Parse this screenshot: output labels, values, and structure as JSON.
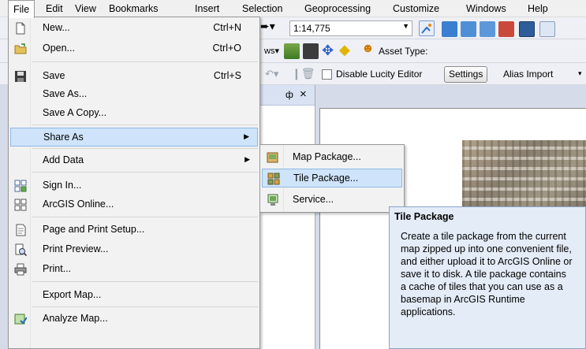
{
  "menubar": {
    "items": [
      {
        "label": "File",
        "name": "file"
      },
      {
        "label": "Edit",
        "name": "edit"
      },
      {
        "label": "View",
        "name": "view"
      },
      {
        "label": "Bookmarks",
        "name": "bookmarks"
      },
      {
        "label": "Insert",
        "name": "insert"
      },
      {
        "label": "Selection",
        "name": "selection"
      },
      {
        "label": "Geoprocessing",
        "name": "geoprocessing"
      },
      {
        "label": "Customize",
        "name": "customize"
      },
      {
        "label": "Windows",
        "name": "windows"
      },
      {
        "label": "Help",
        "name": "help"
      }
    ]
  },
  "toolbar": {
    "scale_value": "1:14,775",
    "asset_type_label": "Asset Type:",
    "disable_lucity_label": "Disable Lucity Editor",
    "settings_label": "Settings",
    "alias_import_label": "Alias Import",
    "pane_pin_glyph": "ф",
    "pane_close_glyph": "×"
  },
  "file_menu": {
    "new": {
      "label": "New...",
      "shortcut": "Ctrl+N"
    },
    "open": {
      "label": "Open...",
      "shortcut": "Ctrl+O"
    },
    "save": {
      "label": "Save",
      "shortcut": "Ctrl+S"
    },
    "save_as": {
      "label": "Save As..."
    },
    "save_copy": {
      "label": "Save A Copy..."
    },
    "share_as": {
      "label": "Share As"
    },
    "add_data": {
      "label": "Add Data"
    },
    "sign_in": {
      "label": "Sign In..."
    },
    "arcgis_online": {
      "label": "ArcGIS Online..."
    },
    "page_setup": {
      "label": "Page and Print Setup..."
    },
    "print_preview": {
      "label": "Print Preview..."
    },
    "print": {
      "label": "Print..."
    },
    "export_map": {
      "label": "Export Map..."
    },
    "analyze_map": {
      "label": "Analyze Map..."
    }
  },
  "share_submenu": {
    "map_package": "Map Package...",
    "tile_package": "Tile Package...",
    "service": "Service..."
  },
  "tooltip": {
    "title": "Tile Package",
    "body": "Create a tile package from the current map zipped up into one convenient file, and either upload it to ArcGIS Online or save it to disk. A tile package contains a cache of tiles that you can use as a basemap in ArcGIS Runtime applications."
  },
  "colors": {
    "highlight_bg": "#cfe4fa",
    "highlight_border": "#8fb8e3",
    "tooltip_bg": "#e4ecf7",
    "menu_bg": "#f2f2f2"
  }
}
